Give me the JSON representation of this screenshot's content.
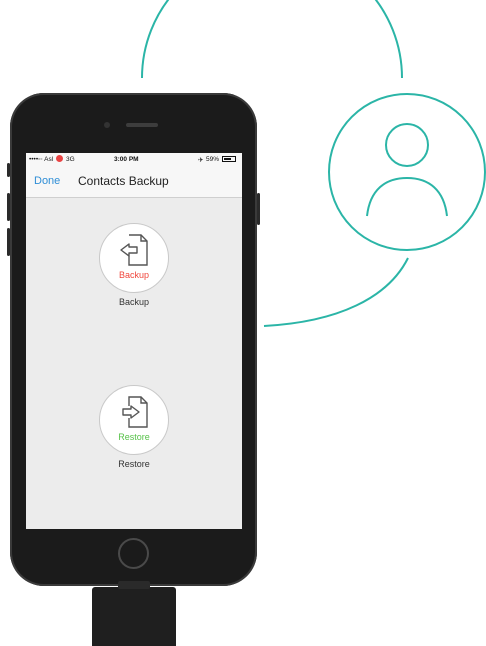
{
  "status_bar": {
    "carrier": "••••◦◦ Asl",
    "network": "3G",
    "time": "3:00 PM",
    "battery": "59%"
  },
  "nav": {
    "done_label": "Done",
    "title": "Contacts Backup"
  },
  "backup": {
    "button_label": "Backup",
    "caption": "Backup",
    "color": "#f0463c",
    "icon": "file-arrow-left-icon"
  },
  "restore": {
    "button_label": "Restore",
    "caption": "Restore",
    "color": "#58c24a",
    "icon": "file-arrow-right-icon"
  },
  "colors": {
    "accent": "#2bb5a7",
    "link": "#2f8ed6"
  }
}
